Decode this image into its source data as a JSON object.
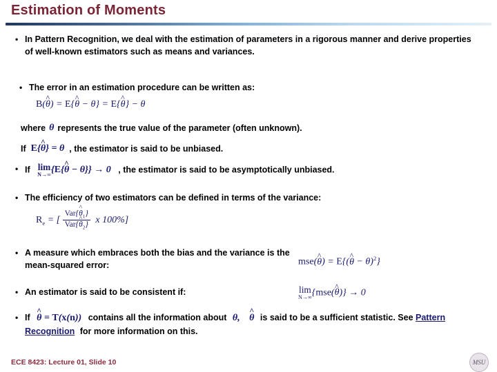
{
  "slide": {
    "title": "Estimation of Moments",
    "footer": "ECE 8423: Lecture 01, Slide 10",
    "logo_text": "MSU"
  },
  "bullets": {
    "b1": "In Pattern Recognition, we deal with the estimation of parameters in a rigorous manner and derive properties of well-known estimators such as means and variances.",
    "b2": "The error in an estimation procedure can be written as:",
    "where_pre": "where",
    "where_theta": "θ",
    "where_post": "represents the true value of the parameter (often unknown).",
    "if_label": "If",
    "if_post": ", the estimator is said to be unbiased.",
    "b3_pre": "If",
    "b3_post": ", the estimator is said to be asymptotically unbiased.",
    "b4": "The efficiency of two estimators can be defined in terms of the variance:",
    "b5": "A measure which embraces both the bias and the variance is the mean-squared error:",
    "b6": "An estimator is said to be consistent if:",
    "b7_pre": "If",
    "b7_mid": "contains all the information about",
    "b7_mid2": "is said to be a sufficient statistic. See",
    "b7_link": "Pattern Recognition",
    "b7_post": "for more information on this."
  },
  "equations": {
    "eq1": "B(θ̂) = E{θ̂ − θ} = E{θ̂} − θ",
    "eq_if": "E{θ̂} = θ",
    "eq_asym": "lim N→∞ {E{θ̂ − θ}} → 0",
    "eq2": "Rₑ = [ Var{θ̂1} / Var{θ̂2} x 100% ]",
    "eq3": "mse(θ̂) = E{(θ̂ − θ)²}",
    "eq4": "lim N→∞ {mse(θ̂)} → 0",
    "eq5": "θ̂ = T(x(n))",
    "eq6_theta": "θ,",
    "eq6_thetahat": "θ̂"
  },
  "colors": {
    "title": "#7a2535",
    "math": "#1a1a6e",
    "footer": "#8a2b3d",
    "rule_left": "#1f3864",
    "rule_right": "#e4f0f9"
  }
}
